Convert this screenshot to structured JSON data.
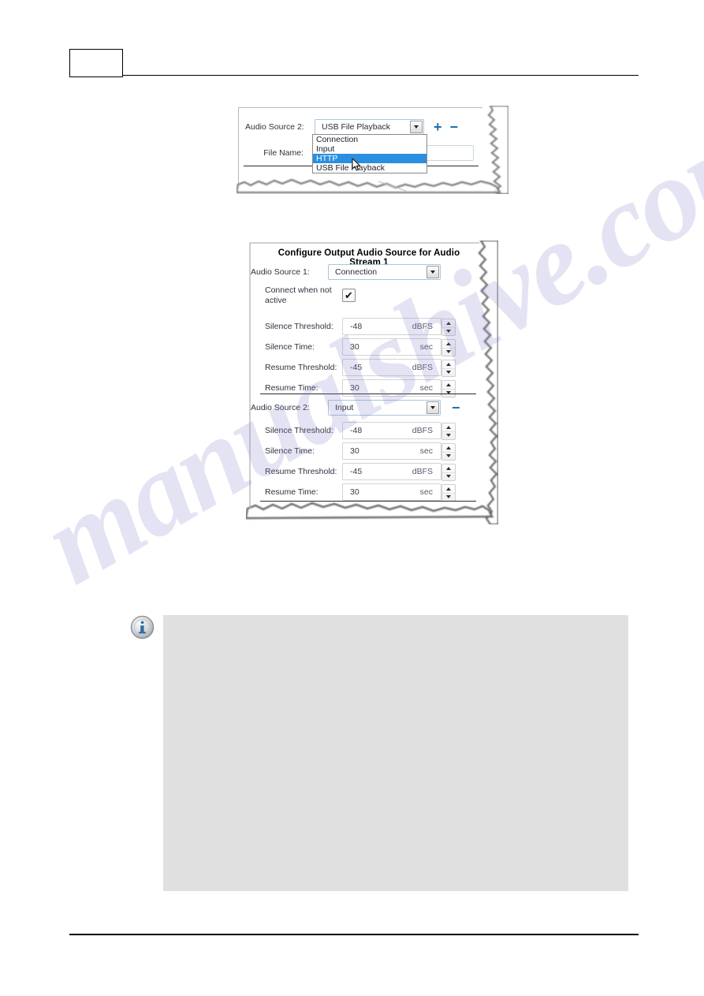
{
  "page": {
    "header": {
      "box_label": "",
      "chapter": ""
    },
    "footer": {
      "text": ""
    }
  },
  "watermark": {
    "text": "manualshive.com"
  },
  "figure1": {
    "name": "audio-source-dropdown-open",
    "rows": {
      "audio_source_label": "Audio Source 2:",
      "audio_source_value": "USB File Playback",
      "file_name_label": "File Name:",
      "file_name_value": ""
    },
    "buttons": {
      "add_label": "+",
      "remove_label": "−"
    },
    "dropdown": {
      "open": true,
      "options": [
        {
          "label": "Connection",
          "selected": false
        },
        {
          "label": "Input",
          "selected": false
        },
        {
          "label": "HTTP",
          "selected": true
        },
        {
          "label": "USB File Playback",
          "selected": false
        }
      ],
      "highlight_color": "#2a8fe0"
    }
  },
  "figure2": {
    "name": "configure-output-audio-source-dialog",
    "title": "Configure Output Audio Source for Audio Stream 1",
    "source1": {
      "label": "Audio Source 1:",
      "value": "Connection",
      "connect_when_not_active_label": "Connect when not active",
      "connect_when_not_active_checked": true,
      "check_glyph": "✔",
      "fields": [
        {
          "label": "Silence Threshold:",
          "value": "-48",
          "unit": "dBFS"
        },
        {
          "label": "Silence Time:",
          "value": "30",
          "unit": "sec"
        },
        {
          "label": "Resume Threshold:",
          "value": "-45",
          "unit": "dBFS"
        },
        {
          "label": "Resume Time:",
          "value": "30",
          "unit": "sec"
        }
      ]
    },
    "source2": {
      "label": "Audio Source 2:",
      "value": "Input",
      "remove_label": "−",
      "fields": [
        {
          "label": "Silence Threshold:",
          "value": "-48",
          "unit": "dBFS"
        },
        {
          "label": "Silence Time:",
          "value": "30",
          "unit": "sec"
        },
        {
          "label": "Resume Threshold:",
          "value": "-45",
          "unit": "dBFS"
        },
        {
          "label": "Resume Time:",
          "value": "30",
          "unit": "sec"
        }
      ]
    }
  },
  "note": {
    "icon": "info-icon",
    "text": ""
  },
  "colors": {
    "accent": "#1f6fa8",
    "highlight": "#2a8fe0",
    "note_bg": "#e0e0e0",
    "combo_border": "#a9c6de"
  }
}
